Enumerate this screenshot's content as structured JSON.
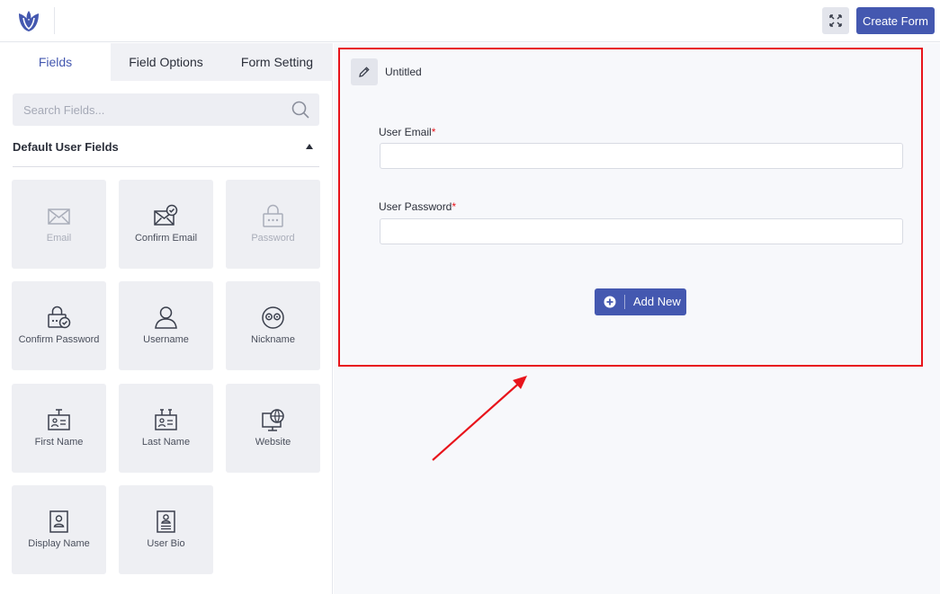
{
  "header": {
    "create_label": "Create Form",
    "logo_icon": "tulip-logo-icon",
    "expand_icon": "fullscreen-expand-icon",
    "brand_color": "#4458b0"
  },
  "sidebar": {
    "tabs": [
      {
        "label": "Fields",
        "active": true
      },
      {
        "label": "Field Options",
        "active": false
      },
      {
        "label": "Form Setting",
        "active": false
      }
    ],
    "search": {
      "placeholder": "Search Fields..."
    },
    "section": {
      "title": "Default User Fields"
    },
    "fields": [
      {
        "label": "Email",
        "icon": "envelope-icon",
        "enabled": false
      },
      {
        "label": "Confirm Email",
        "icon": "envelope-check-icon",
        "enabled": true
      },
      {
        "label": "Password",
        "icon": "lock-icon",
        "enabled": false
      },
      {
        "label": "Confirm Password",
        "icon": "lock-check-icon",
        "enabled": true
      },
      {
        "label": "Username",
        "icon": "user-icon",
        "enabled": true
      },
      {
        "label": "Nickname",
        "icon": "mask-icon",
        "enabled": true
      },
      {
        "label": "First Name",
        "icon": "id-badge-icon",
        "enabled": true
      },
      {
        "label": "Last Name",
        "icon": "id-badge-icon",
        "enabled": true
      },
      {
        "label": "Website",
        "icon": "globe-monitor-icon",
        "enabled": true
      },
      {
        "label": "Display Name",
        "icon": "profile-card-icon",
        "enabled": true
      },
      {
        "label": "User Bio",
        "icon": "profile-doc-icon",
        "enabled": true
      }
    ]
  },
  "form": {
    "title": "Untitled",
    "edit_icon": "pencil-icon",
    "fields": [
      {
        "label": "User Email",
        "required_mark": "*",
        "value": ""
      },
      {
        "label": "User Password",
        "required_mark": "*",
        "value": ""
      }
    ],
    "add_new_label": "Add New",
    "highlight_color": "#e8141b"
  }
}
